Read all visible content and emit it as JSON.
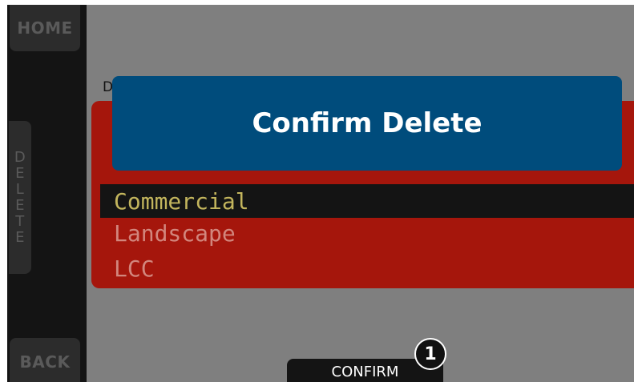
{
  "sidebar": {
    "home_label": "HOME",
    "delete_letters": [
      "D",
      "E",
      "L",
      "E",
      "T",
      "E"
    ],
    "back_label": "BACK"
  },
  "peek_text": "D",
  "dialog": {
    "title": "Confirm Delete"
  },
  "list": {
    "items": [
      "Commercial",
      "Landscape",
      "LCC"
    ],
    "selected_index": 0
  },
  "footer": {
    "confirm_label": "CONFIRM"
  },
  "callout": {
    "number": "1"
  },
  "colors": {
    "screen_bg": "#7f7f7f",
    "list_bg": "#a5160c",
    "dialog_bg": "#004c7c",
    "selected_text": "#c3b55d",
    "item_text": "#d2867d"
  }
}
